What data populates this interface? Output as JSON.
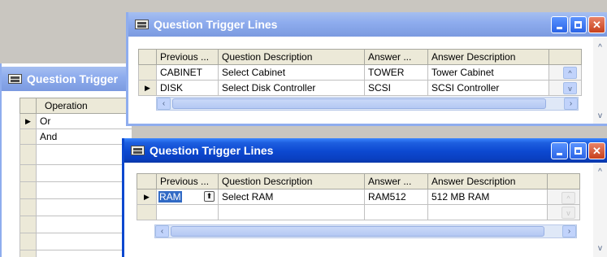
{
  "back_window": {
    "title": "Question Trigger",
    "column_header": "Operation",
    "rows": [
      "Or",
      "And",
      "",
      "",
      "",
      "",
      "",
      "",
      ""
    ]
  },
  "window1": {
    "title": "Question Trigger Lines",
    "columns": [
      "Previous ...",
      "Question Description",
      "Answer ...",
      "Answer Description"
    ],
    "rows": [
      {
        "current": false,
        "cells": [
          "CABINET",
          "Select Cabinet",
          "TOWER",
          "Tower Cabinet"
        ]
      },
      {
        "current": true,
        "cells": [
          "DISK",
          "Select Disk Controller",
          "SCSI",
          "SCSI Controller"
        ]
      }
    ]
  },
  "window2": {
    "title": "Question Trigger Lines",
    "columns": [
      "Previous ...",
      "Question Description",
      "Answer ...",
      "Answer Description"
    ],
    "rows": [
      {
        "current": true,
        "cells": [
          "RAM",
          "Select RAM",
          "RAM512",
          "512 MB RAM"
        ]
      },
      {
        "current": false,
        "cells": [
          "",
          "",
          "",
          ""
        ]
      }
    ]
  },
  "icons": {
    "row_pointer": "▶",
    "scroll_left": "‹",
    "scroll_right": "›",
    "scroll_up": "^",
    "scroll_down": "v"
  },
  "colors": {
    "title_active": "#0c48d0",
    "title_inactive": "#8fadee",
    "close_button": "#c7401c",
    "selection": "#316ac5"
  }
}
